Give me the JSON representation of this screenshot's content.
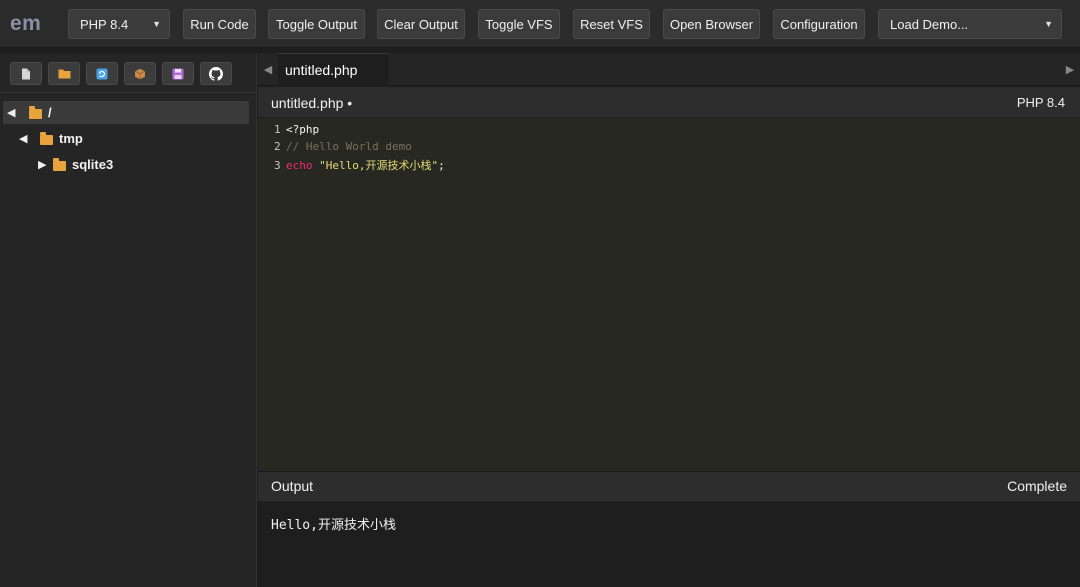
{
  "app": {
    "logo": "em"
  },
  "toolbar": {
    "php_version": {
      "selected": "PHP 8.4"
    },
    "run_code": "Run Code",
    "toggle_output": "Toggle Output",
    "clear_output": "Clear Output",
    "toggle_vfs": "Toggle VFS",
    "reset_vfs": "Reset VFS",
    "open_browser": "Open Browser",
    "configuration": "Configuration",
    "load_demo": {
      "selected": "Load Demo..."
    }
  },
  "sidebar": {
    "tools": [
      {
        "name": "new-file-icon",
        "color": "#d6d6d6"
      },
      {
        "name": "new-folder-icon",
        "color": "#e8a33c"
      },
      {
        "name": "refresh-icon",
        "color": "#4aa3e8"
      },
      {
        "name": "package-icon",
        "color": "#c98b4a"
      },
      {
        "name": "save-icon",
        "color": "#b06ad6"
      },
      {
        "name": "github-icon",
        "color": "#ffffff"
      }
    ],
    "tree": [
      {
        "label": "/",
        "expanded": true,
        "selected": true
      },
      {
        "label": "tmp",
        "expanded": true
      },
      {
        "label": "sqlite3",
        "expanded": false
      }
    ]
  },
  "tabs": [
    {
      "label": "untitled.php",
      "active": true
    }
  ],
  "editor": {
    "title": "untitled.php •",
    "language": "PHP 8.4",
    "lines": [
      {
        "num": "1",
        "open_tag": "<?php"
      },
      {
        "num": "2",
        "comment": "// Hello World demo"
      },
      {
        "num": "3",
        "keyword": "echo",
        "string": "\"Hello,开源技术小栈\"",
        "end": ";"
      }
    ]
  },
  "output": {
    "title": "Output",
    "status": "Complete",
    "text": "Hello,开源技术小栈"
  },
  "colors": {
    "background": "#1e1e1e",
    "toolbar": "#2b2b2b",
    "editor_background": "#272822",
    "folder": "#e8a33c",
    "keyword": "#f92672",
    "string": "#e6db74",
    "comment": "#75715e"
  }
}
